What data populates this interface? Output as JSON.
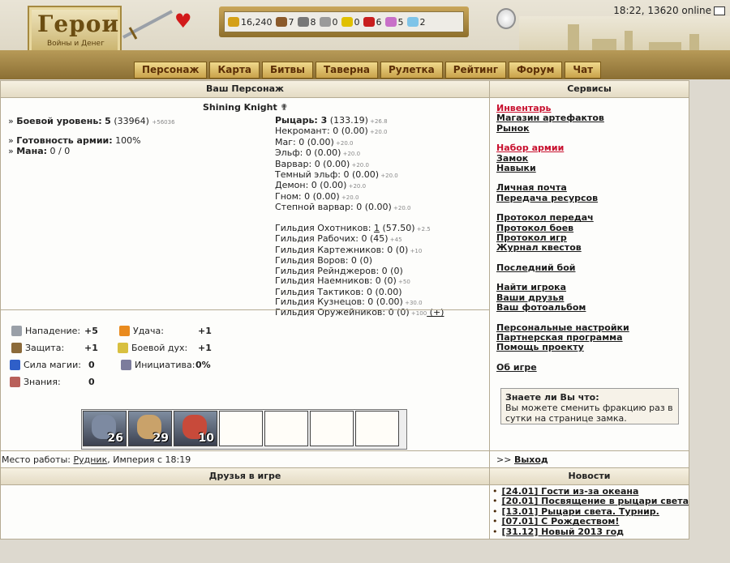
{
  "header": {
    "logo_title": "Герои",
    "logo_subtitle": "Войны и Денег",
    "clock": "18:22, 13620 online",
    "resources": [
      {
        "icon": "gold-icon",
        "color": "#d4a017",
        "value": "16,240"
      },
      {
        "icon": "wood-icon",
        "color": "#8b5a2b",
        "value": "7"
      },
      {
        "icon": "ore-icon",
        "color": "#777777",
        "value": "8"
      },
      {
        "icon": "mercury-icon",
        "color": "#9a9a9a",
        "value": "0"
      },
      {
        "icon": "sulfur-icon",
        "color": "#e0c000",
        "value": "0"
      },
      {
        "icon": "crystal-icon",
        "color": "#c81e1e",
        "value": "6"
      },
      {
        "icon": "gems-icon",
        "color": "#c870c8",
        "value": "5"
      },
      {
        "icon": "diamond-icon",
        "color": "#7fc4e8",
        "value": "2"
      }
    ]
  },
  "nav": [
    "Персонаж",
    "Карта",
    "Битвы",
    "Таверна",
    "Рулетка",
    "Рейтинг",
    "Форум",
    "Чат"
  ],
  "character": {
    "panel_title": "Ваш Персонаж",
    "name": "Shining Knight",
    "level_label": "Боевой уровень:",
    "level": "5",
    "level_exp": "(33964)",
    "level_next": "+56036",
    "army_label": "Готовность армии:",
    "army_value": "100%",
    "mana_label": "Мана:",
    "mana_value": "0 / 0",
    "factions": [
      {
        "name": "Рыцарь:",
        "value": "3",
        "detail": "(133.19)",
        "plus": "+26.8",
        "bold": true
      },
      {
        "name": "Некромант:",
        "value": "0 (0.00)",
        "plus": "+20.0"
      },
      {
        "name": "Маг:",
        "value": "0 (0.00)",
        "plus": "+20.0"
      },
      {
        "name": "Эльф:",
        "value": "0 (0.00)",
        "plus": "+20.0"
      },
      {
        "name": "Варвар:",
        "value": "0 (0.00)",
        "plus": "+20.0"
      },
      {
        "name": "Темный эльф:",
        "value": "0 (0.00)",
        "plus": "+20.0"
      },
      {
        "name": "Демон:",
        "value": "0 (0.00)",
        "plus": "+20.0"
      },
      {
        "name": "Гном:",
        "value": "0 (0.00)",
        "plus": "+20.0"
      },
      {
        "name": "Степной варвар:",
        "value": "0 (0.00)",
        "plus": "+20.0"
      }
    ],
    "guilds": [
      {
        "name": "Гильдия Охотников:",
        "value": "1",
        "detail": "(57.50)",
        "plus": "+2.5",
        "underline": true
      },
      {
        "name": "Гильдия Рабочих:",
        "value": "0 (45)",
        "plus": "+45"
      },
      {
        "name": "Гильдия Картежников:",
        "value": "0 (0)",
        "plus": "+10"
      },
      {
        "name": "Гильдия Воров:",
        "value": "0 (0)",
        "plus": ""
      },
      {
        "name": "Гильдия Рейнджеров:",
        "value": "0 (0)",
        "plus": ""
      },
      {
        "name": "Гильдия Наемников:",
        "value": "0 (0)",
        "plus": "+50"
      },
      {
        "name": "Гильдия Тактиков:",
        "value": "0 (0.00)",
        "plus": ""
      },
      {
        "name": "Гильдия Кузнецов:",
        "value": "0 (0.00)",
        "plus": "+30.0"
      },
      {
        "name": "Гильдия Оружейников:",
        "value": "0 (0)",
        "plus": "+100",
        "extra": "(+)"
      }
    ],
    "attributes": [
      {
        "label": "Нападение:",
        "value": "+5",
        "icon": "swords-icon"
      },
      {
        "label": "Защита:",
        "value": "+1",
        "icon": "shield-icon"
      },
      {
        "label": "Сила магии:",
        "value": "0",
        "icon": "wand-icon"
      },
      {
        "label": "Знания:",
        "value": "0",
        "icon": "book-icon"
      },
      {
        "label": "Удача:",
        "value": "+1",
        "icon": "rainbow-icon"
      },
      {
        "label": "Боевой дух:",
        "value": "+1",
        "icon": "wings-icon"
      },
      {
        "label": "Инициатива:",
        "value": "0%",
        "icon": "hourglass-icon"
      }
    ],
    "army": [
      {
        "count": "26",
        "color": "#7d8aa1",
        "icon": "swordsman-icon"
      },
      {
        "count": "29",
        "color": "#c9a26a",
        "icon": "archer-icon"
      },
      {
        "count": "10",
        "color": "#c84a3a",
        "icon": "griffin-icon"
      },
      {
        "count": ""
      },
      {
        "count": ""
      },
      {
        "count": ""
      },
      {
        "count": ""
      }
    ],
    "work_label": "Место работы:",
    "work_place": "Рудник",
    "work_rest": ", Империя с 18:19"
  },
  "services": {
    "panel_title": "Сервисы",
    "groups": [
      [
        {
          "label": "Инвентарь",
          "red": true
        },
        {
          "label": "Магазин артефактов"
        },
        {
          "label": "Рынок"
        }
      ],
      [
        {
          "label": "Набор армии",
          "red": true
        },
        {
          "label": "Замок"
        },
        {
          "label": "Навыки"
        }
      ],
      [
        {
          "label": "Личная почта"
        },
        {
          "label": "Передача ресурсов"
        }
      ],
      [
        {
          "label": "Протокол передач"
        },
        {
          "label": "Протокол боев"
        },
        {
          "label": "Протокол игр"
        },
        {
          "label": "Журнал квестов"
        }
      ],
      [
        {
          "label": "Последний бой"
        }
      ],
      [
        {
          "label": "Найти игрока"
        },
        {
          "label": "Ваши друзья"
        },
        {
          "label": "Ваш фотоальбом"
        }
      ],
      [
        {
          "label": "Персональные настройки"
        },
        {
          "label": "Партнерская программа"
        },
        {
          "label": "Помощь проекту"
        }
      ],
      [
        {
          "label": "Об игре"
        }
      ]
    ],
    "tip_title": "Знаете ли Вы что:",
    "tip_text": "Вы можете сменить фракцию раз в сутки на странице замка.",
    "exit_prefix": ">>",
    "exit_label": "Выход"
  },
  "friends": {
    "panel_title": "Друзья в игре"
  },
  "news": {
    "panel_title": "Новости",
    "items": [
      "[24.01] Гости из-за океана",
      "[20.01] Посвящение в рыцари света",
      "[13.01] Рыцари света. Турнир.",
      "[07.01] С Рождеством!",
      "[31.12] Новый 2013 год"
    ]
  }
}
